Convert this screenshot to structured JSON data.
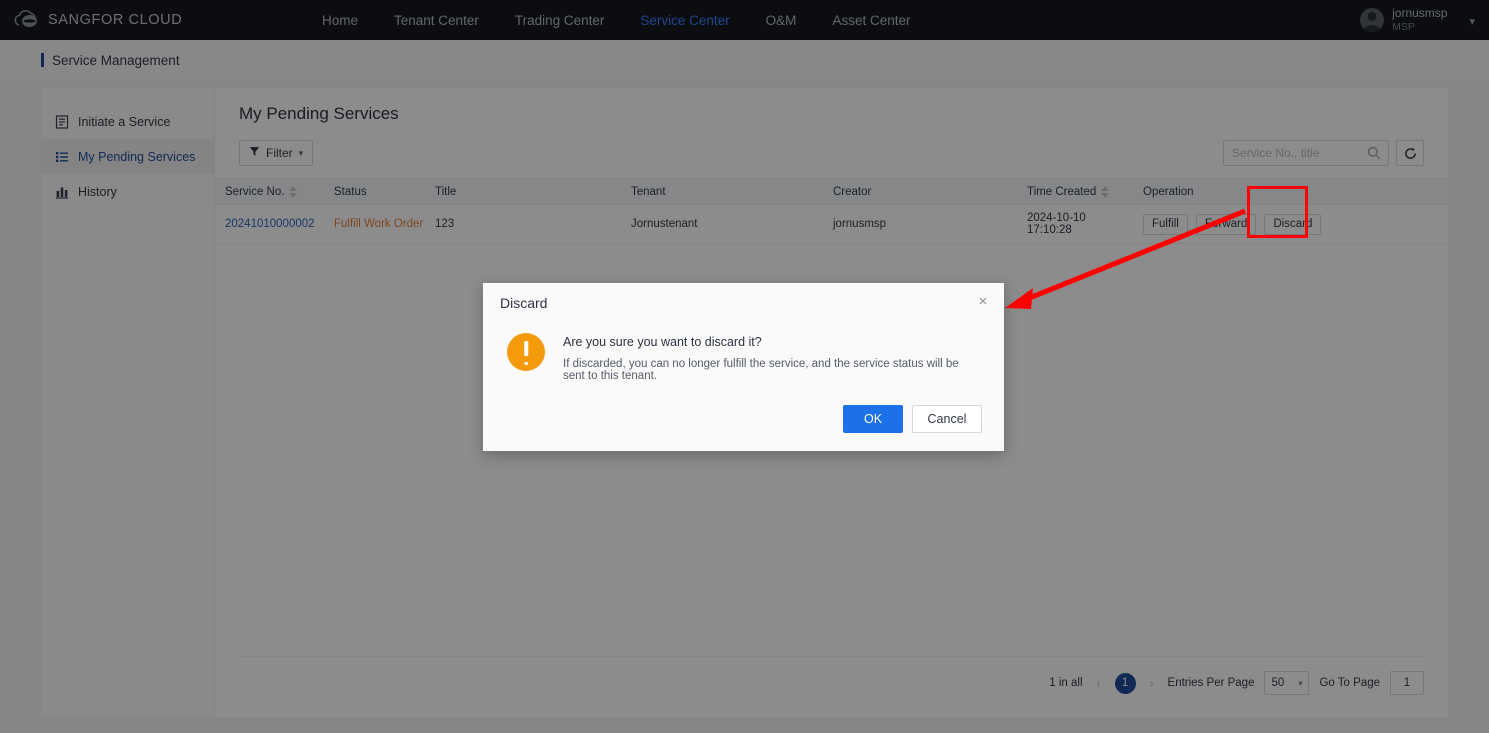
{
  "topnav": {
    "brand": "SANGFOR CLOUD",
    "brand_icon": "cloud-logo-icon",
    "items": [
      {
        "label": "Home",
        "active": false
      },
      {
        "label": "Tenant Center",
        "active": false
      },
      {
        "label": "Trading Center",
        "active": false
      },
      {
        "label": "Service Center",
        "active": true
      },
      {
        "label": "O&M",
        "active": false
      },
      {
        "label": "Asset Center",
        "active": false
      }
    ],
    "user": {
      "name": "jornusmsp",
      "role": "MSP",
      "caret": "▾"
    }
  },
  "page_header": {
    "title": "Service Management"
  },
  "sidebar": {
    "items": [
      {
        "label": "Initiate a Service",
        "icon": "form-icon",
        "active": false
      },
      {
        "label": "My Pending Services",
        "icon": "list-icon",
        "active": true
      },
      {
        "label": "History",
        "icon": "chart-bar-icon",
        "active": false
      }
    ]
  },
  "content": {
    "title": "My Pending Services",
    "toolbar": {
      "filter_label": "Filter",
      "filter_caret": "▾",
      "search_placeholder": "Service No., title",
      "search_value": "",
      "refresh_label": "refresh-icon"
    },
    "table": {
      "columns": [
        {
          "label": "Service No.",
          "sortable": true
        },
        {
          "label": "Status",
          "sortable": false
        },
        {
          "label": "Title",
          "sortable": false
        },
        {
          "label": "Tenant",
          "sortable": false
        },
        {
          "label": "Creator",
          "sortable": false
        },
        {
          "label": "Time Created",
          "sortable": true
        },
        {
          "label": "Operation",
          "sortable": false
        }
      ],
      "rows": [
        {
          "service_no": "20241010000002",
          "status": "Fulfill Work Order",
          "title": "123",
          "tenant": "Jornustenant",
          "creator": "jornusmsp",
          "time_created": "2024-10-10 17:10:28",
          "operations": [
            "Fulfill",
            "Forward",
            "Discard"
          ]
        }
      ]
    },
    "pagination": {
      "total_label": "1 in all",
      "prev": "‹",
      "current_page": "1",
      "next": "›",
      "entries_label": "Entries Per Page",
      "entries_value": "50",
      "entries_caret": "▾",
      "goto_label": "Go To Page",
      "goto_value": "1"
    }
  },
  "modal": {
    "title": "Discard",
    "close": "×",
    "icon": "warning-exclamation-icon",
    "question": "Are you sure you want to discard it?",
    "description": "If discarded, you can no longer fulfill the service, and the service status will be sent to this tenant.",
    "ok_label": "OK",
    "cancel_label": "Cancel"
  },
  "annotation": {
    "highlight_color": "#ff0000",
    "target": "discard-button"
  }
}
